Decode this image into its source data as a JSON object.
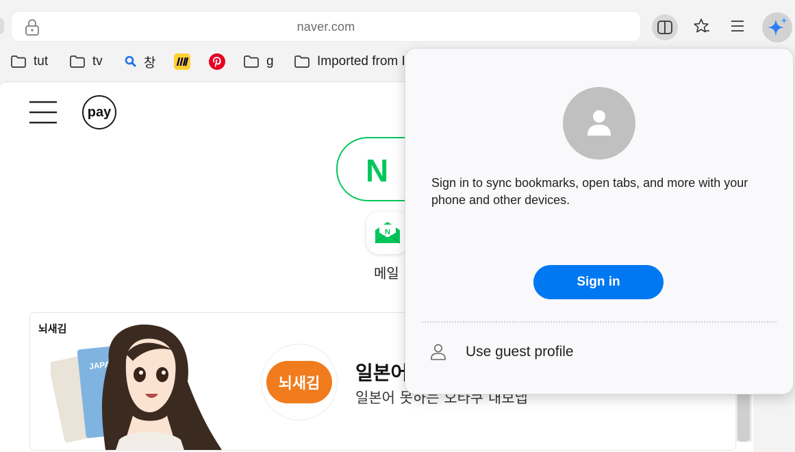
{
  "browser": {
    "url": "naver.com",
    "favorites": [
      {
        "label": "tut",
        "icon": "folder-icon"
      },
      {
        "label": "tv",
        "icon": "folder-icon"
      },
      {
        "label": "창",
        "icon": "search-icon"
      },
      {
        "label": "",
        "icon": "miro-icon"
      },
      {
        "label": "",
        "icon": "pinterest-icon"
      },
      {
        "label": "g",
        "icon": "folder-icon"
      },
      {
        "label": "Imported from I",
        "icon": "folder-icon"
      }
    ]
  },
  "page": {
    "pay_label": "pay",
    "logo_letter": "N",
    "mail_label": "메일",
    "ad": {
      "brand": "뇌새김",
      "logo_text": "뇌새김",
      "title": "일본어",
      "subtitle": "일본어 못하는 오타쿠 내보냅"
    }
  },
  "profile_flyout": {
    "sync_message": "Sign in to sync bookmarks, open tabs, and more with your phone and other devices.",
    "sign_in_label": "Sign in",
    "guest_label": "Use guest profile"
  },
  "colors": {
    "naver_green": "#03c75a",
    "sign_in_blue": "#0078f2",
    "ad_orange": "#f07c1e"
  }
}
